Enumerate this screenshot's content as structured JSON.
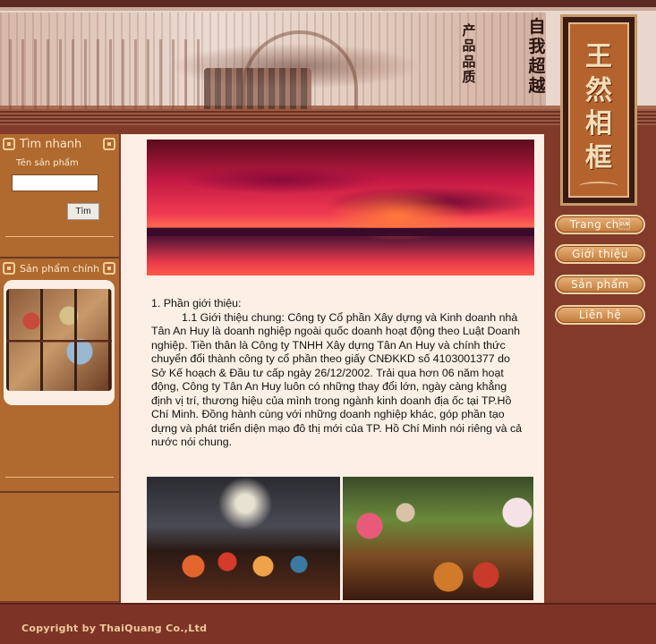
{
  "header": {
    "slogan_left": "产品品质",
    "slogan_right": "自我超越",
    "logo_text": "王然相框"
  },
  "sidebar": {
    "search_title": "Tìm nhanh",
    "search_label": "Tên sản phẩm",
    "search_value": "",
    "search_button": "Tìm",
    "products_title": "Sản phẩm chính"
  },
  "content": {
    "heading": "1. Phần giới thiệu:",
    "paragraph": "1.1 Giới thiệu chung: Công ty Cổ phần Xây dựng và Kinh doanh nhà Tân An Huy là doanh nghiệp ngoài quốc doanh hoạt động theo Luật Doanh nghiệp. Tiền thân là Công ty TNHH Xây dựng Tân An Huy  và chính thức chuyển đổi thành công ty cổ phần theo giấy CNĐKKD số 4103001377 do Sở Kế hoạch & Đầu tư cấp ngày 26/12/2002. Trải qua hơn 06 năm hoạt động, Công ty Tân An Huy luôn có những thay đổi lớn, ngày càng khẳng định vị trí, thương hiệu của mình trong ngành kinh doanh địa ốc tại TP.Hồ Chí Minh. Đồng hành cùng với những doanh nghiệp khác, góp phần tạo dựng và phát triển diện mạo đô thị mới của TP. Hồ Chí Minh nói riêng và cả nước nói chung."
  },
  "nav": {
    "items": [
      "Trang ch\u001a",
      "Giới thiệu",
      "Sản phẩm",
      "Liên hệ"
    ]
  },
  "footer": {
    "copyright": "Copyright by ThaiQuang Co.,Ltd"
  },
  "colors": {
    "page_bg": "#823a2a",
    "sidebar_bg": "#b0692f",
    "content_bg": "#fcf0e6",
    "nav_button": "#d5935a"
  }
}
